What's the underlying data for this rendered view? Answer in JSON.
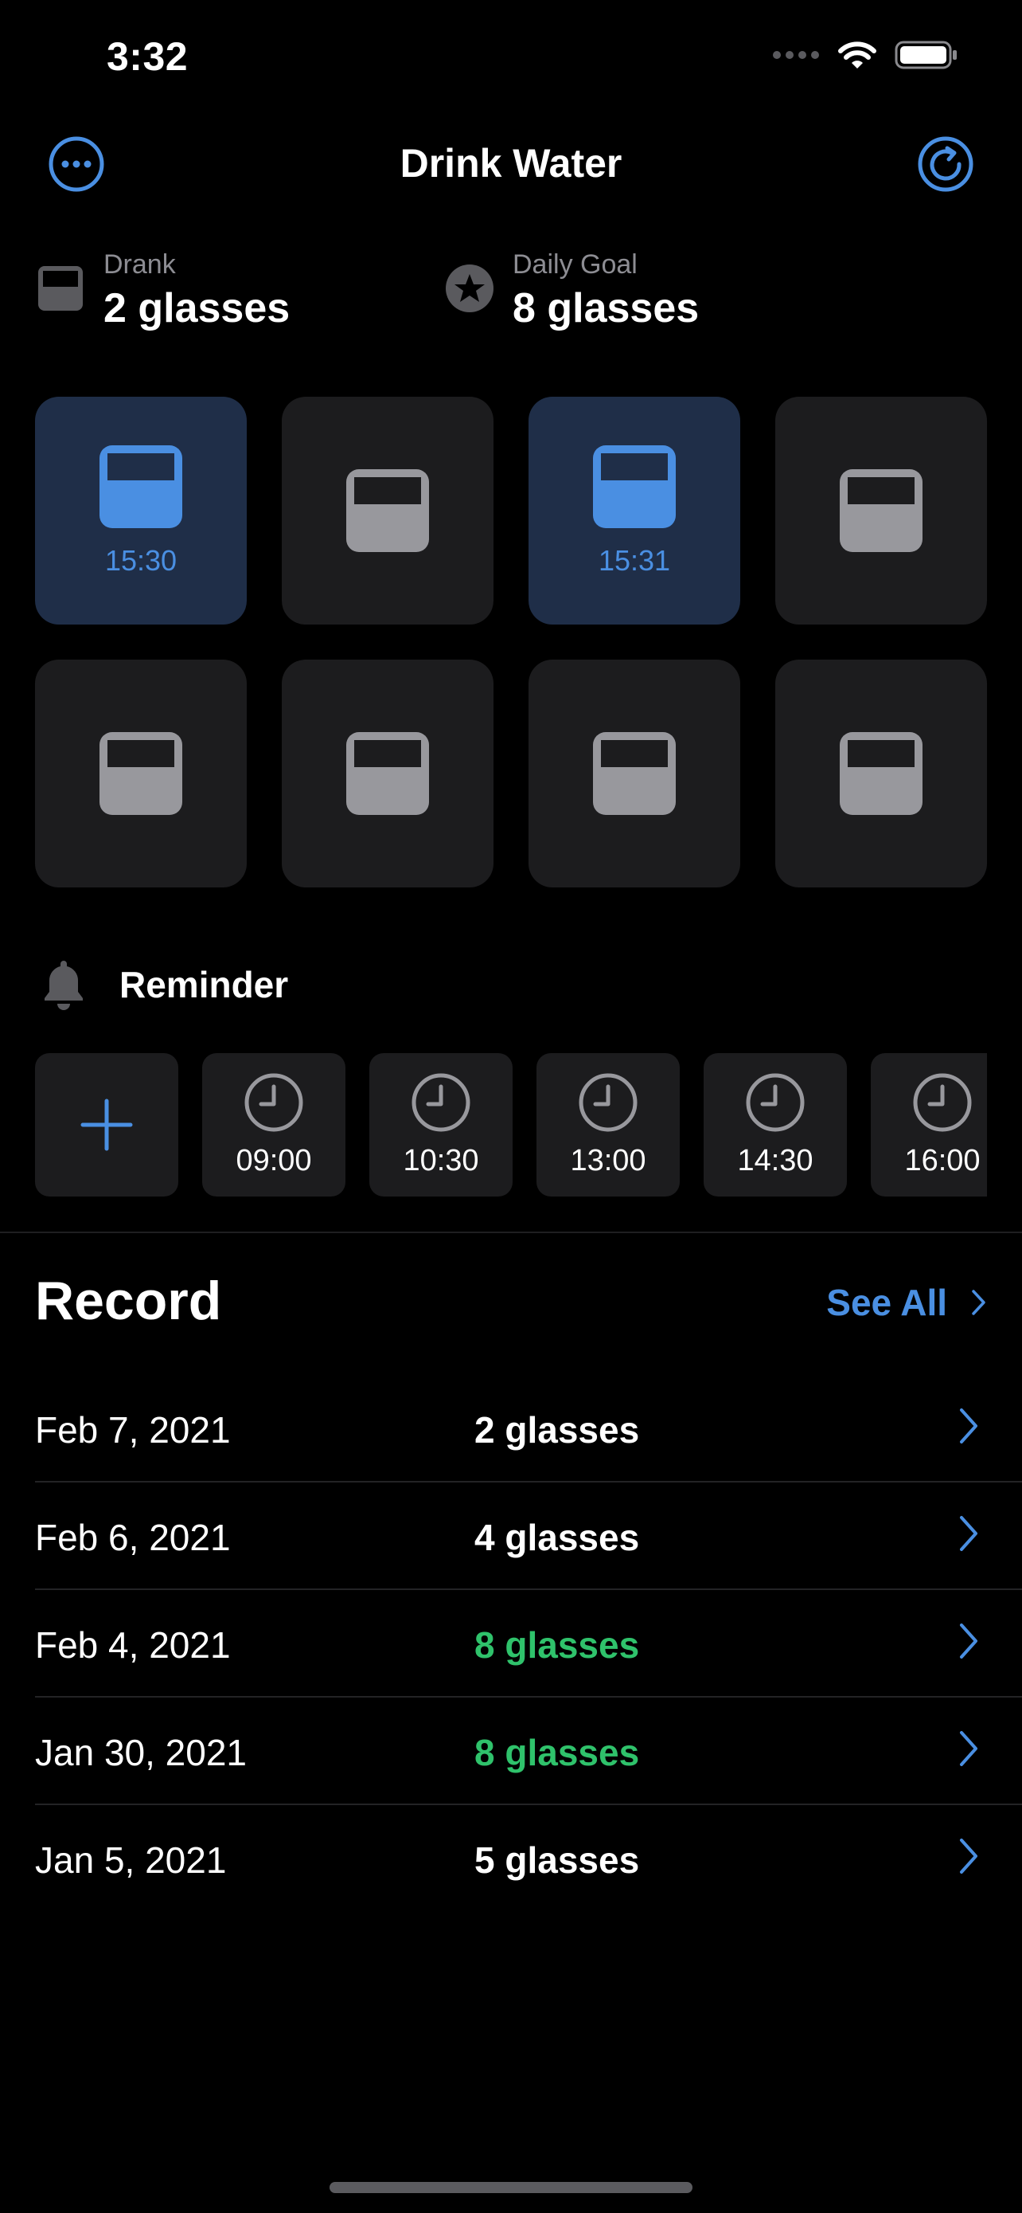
{
  "status_bar": {
    "time": "3:32",
    "signal_icon": "signal-dots-icon",
    "wifi_icon": "wifi-icon",
    "battery_icon": "battery-icon"
  },
  "nav": {
    "title": "Drink Water",
    "left_icon": "more-icon",
    "right_icon": "refresh-icon"
  },
  "summary": {
    "drank": {
      "label": "Drank",
      "value": "2 glasses",
      "icon": "glass-icon"
    },
    "goal": {
      "label": "Daily Goal",
      "value": "8 glasses",
      "icon": "star-icon"
    }
  },
  "glasses": [
    {
      "filled": true,
      "time": "15:30"
    },
    {
      "filled": false,
      "time": ""
    },
    {
      "filled": true,
      "time": "15:31"
    },
    {
      "filled": false,
      "time": ""
    },
    {
      "filled": false,
      "time": ""
    },
    {
      "filled": false,
      "time": ""
    },
    {
      "filled": false,
      "time": ""
    },
    {
      "filled": false,
      "time": ""
    }
  ],
  "reminder": {
    "title": "Reminder",
    "icon": "bell-icon",
    "add_icon": "plus-icon",
    "times": [
      "09:00",
      "10:30",
      "13:00",
      "14:30",
      "16:00"
    ]
  },
  "record": {
    "title": "Record",
    "see_all": "See All",
    "rows": [
      {
        "date": "Feb 7, 2021",
        "amount": "2 glasses",
        "goal_met": false
      },
      {
        "date": "Feb 6, 2021",
        "amount": "4 glasses",
        "goal_met": false
      },
      {
        "date": "Feb 4, 2021",
        "amount": "8 glasses",
        "goal_met": true
      },
      {
        "date": "Jan 30, 2021",
        "amount": "8 glasses",
        "goal_met": true
      },
      {
        "date": "Jan 5, 2021",
        "amount": "5 glasses",
        "goal_met": false
      }
    ]
  },
  "colors": {
    "accent": "#4a8fe2",
    "success": "#2fc26b",
    "tile": "#1c1c1e",
    "tile_filled": "#1f2e48",
    "secondary_text": "#8d8d93",
    "empty_glass": "#98989d"
  }
}
